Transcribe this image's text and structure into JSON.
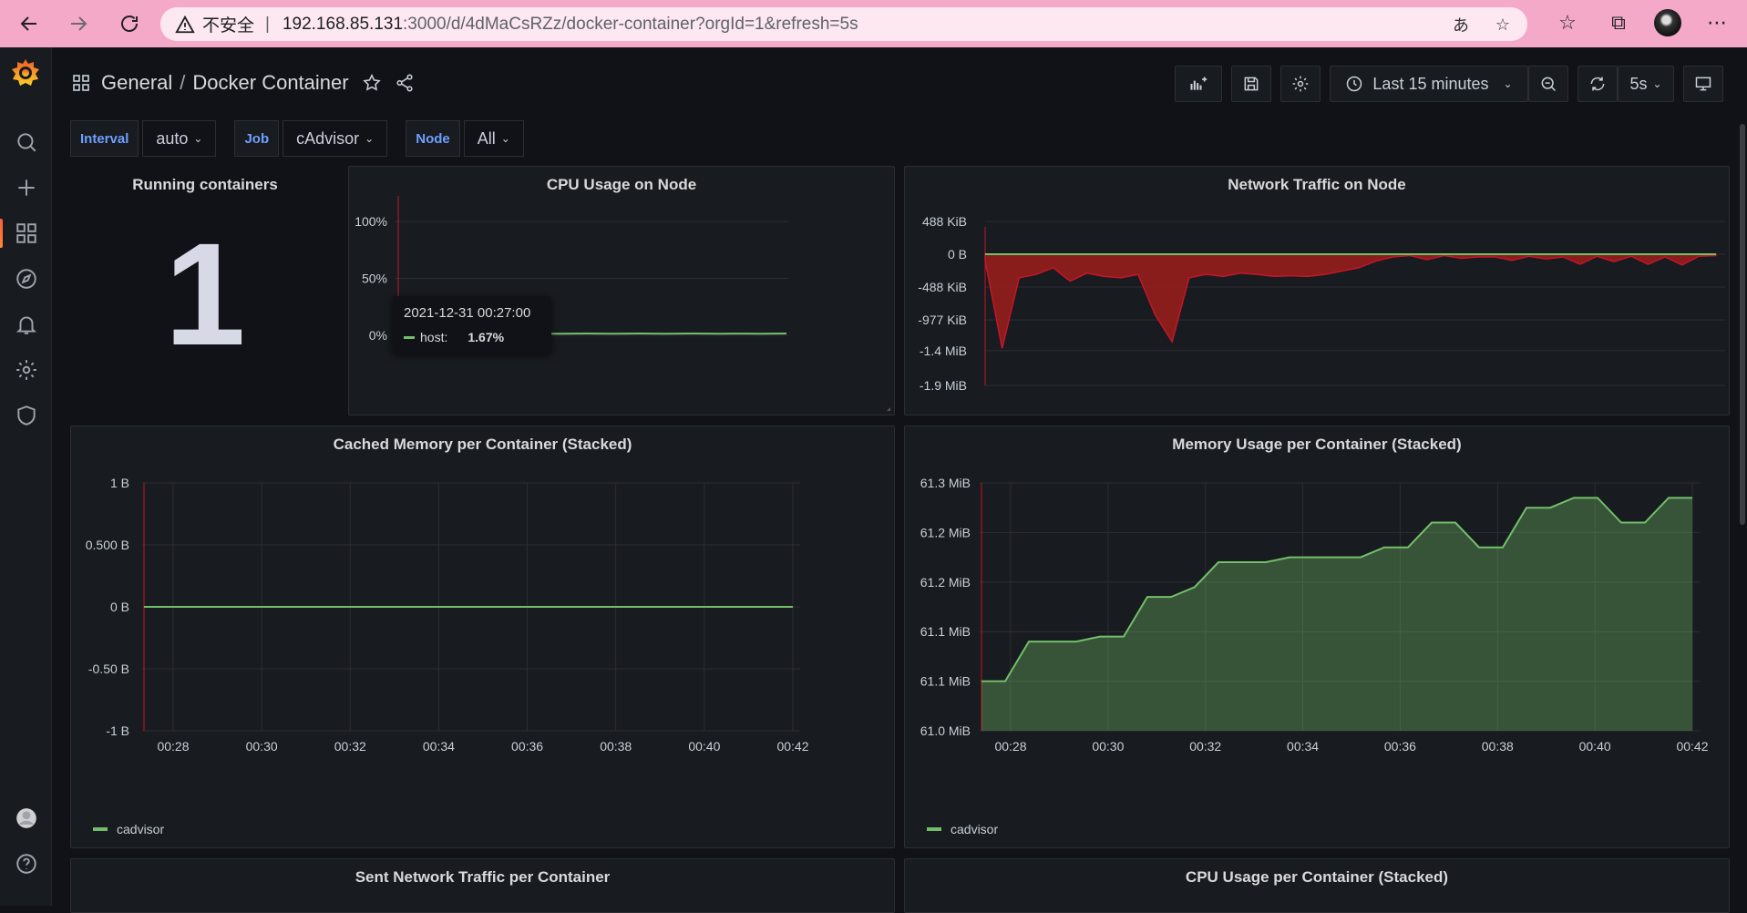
{
  "browser": {
    "insecure_label": "不安全",
    "url_host": "192.168.85.131",
    "url_path": ":3000/d/4dMaCsRZz/docker-container?orgId=1&refresh=5s"
  },
  "header": {
    "folder": "General",
    "dashboard_title": "Docker Container",
    "time_range": "Last 15 minutes",
    "refresh_interval": "5s"
  },
  "variables": [
    {
      "label": "Interval",
      "value": "auto"
    },
    {
      "label": "Job",
      "value": "cAdvisor"
    },
    {
      "label": "Node",
      "value": "All"
    }
  ],
  "colors": {
    "accent": "#6e9fff",
    "series_green": "#73bf69",
    "series_red": "#c4162a",
    "threshold_red": "#c4162a"
  },
  "panels": {
    "running": {
      "title": "Running containers",
      "value": "1"
    },
    "cpu_node": {
      "title": "CPU Usage on Node",
      "tooltip_time": "2021-12-31 00:27:00",
      "tooltip_series": "host:",
      "tooltip_value": "1.67%"
    },
    "net_node": {
      "title": "Network Traffic on Node"
    },
    "cached_mem": {
      "title": "Cached Memory per Container (Stacked)",
      "legend": "cadvisor"
    },
    "mem_usage": {
      "title": "Memory Usage per Container (Stacked)",
      "legend": "cadvisor"
    },
    "sent_net": {
      "title": "Sent Network Traffic per Container"
    },
    "cpu_container": {
      "title": "CPU Usage per Container (Stacked)"
    }
  },
  "chart_data": [
    {
      "id": "cpu_node",
      "type": "line",
      "title": "CPU Usage on Node",
      "y_ticks": [
        "100%",
        "50%",
        "0%"
      ],
      "ylim": [
        0,
        100
      ],
      "series": [
        {
          "name": "host",
          "values": [
            1.7,
            1.6,
            1.5,
            1.4,
            1.5,
            1.4,
            1.5,
            1.6,
            1.4,
            1.5,
            1.6,
            1.5,
            1.4,
            1.5,
            1.6,
            1.5,
            1.4,
            1.5,
            1.6,
            1.5,
            1.4,
            1.5,
            1.6,
            1.5,
            1.4,
            1.5,
            1.5,
            1.4,
            1.5,
            1.6
          ]
        }
      ]
    },
    {
      "id": "net_node",
      "type": "area",
      "title": "Network Traffic on Node",
      "y_ticks": [
        "488 KiB",
        "0 B",
        "-488 KiB",
        "-977 KiB",
        "-1.4 MiB",
        "-1.9 MiB"
      ],
      "ylim_kib": [
        -1950,
        488
      ],
      "series": [
        {
          "name": "",
          "values": [
            -100,
            -1400,
            -350,
            -300,
            -200,
            -400,
            -280,
            -330,
            -350,
            -300,
            -900,
            -1300,
            -350,
            -300,
            -330,
            -280,
            -300,
            -330,
            -320,
            -330,
            -300,
            -250,
            -200,
            -100,
            -40,
            -20,
            -80,
            -20,
            -60,
            -40,
            -40,
            -90,
            -30,
            -70,
            -40,
            -150,
            -30,
            -110,
            -30,
            -150,
            -40,
            -160,
            -30,
            -20
          ]
        }
      ]
    },
    {
      "id": "cached_mem",
      "type": "line",
      "title": "Cached Memory per Container (Stacked)",
      "categories": [
        "00:28",
        "00:30",
        "00:32",
        "00:34",
        "00:36",
        "00:38",
        "00:40",
        "00:42"
      ],
      "y_ticks": [
        "1 B",
        "0.500 B",
        "0 B",
        "-0.50 B",
        "-1 B"
      ],
      "ylim": [
        -1,
        1
      ],
      "series": [
        {
          "name": "cadvisor",
          "values": [
            0,
            0,
            0,
            0,
            0,
            0,
            0,
            0
          ]
        }
      ]
    },
    {
      "id": "mem_usage",
      "type": "area",
      "title": "Memory Usage per Container (Stacked)",
      "categories": [
        "00:28",
        "00:30",
        "00:32",
        "00:34",
        "00:36",
        "00:38",
        "00:40",
        "00:42"
      ],
      "y_ticks": [
        "61.3 MiB",
        "61.2 MiB",
        "61.2 MiB",
        "61.1 MiB",
        "61.1 MiB",
        "61.0 MiB"
      ],
      "ylim": [
        61.0,
        61.25
      ],
      "series": [
        {
          "name": "cadvisor",
          "values": [
            61.05,
            61.05,
            61.09,
            61.09,
            61.09,
            61.095,
            61.095,
            61.135,
            61.135,
            61.145,
            61.17,
            61.17,
            61.17,
            61.175,
            61.175,
            61.175,
            61.175,
            61.185,
            61.185,
            61.21,
            61.21,
            61.185,
            61.185,
            61.225,
            61.225,
            61.235,
            61.235,
            61.21,
            61.21,
            61.235,
            61.235
          ]
        }
      ]
    }
  ]
}
